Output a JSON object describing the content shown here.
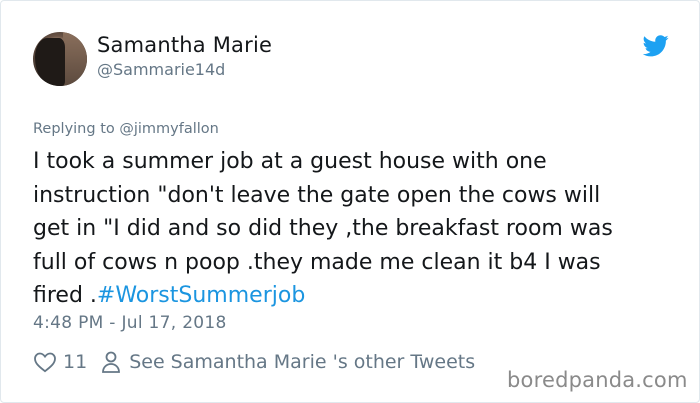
{
  "user": {
    "display_name": "Samantha Marie",
    "handle": "@Sammarie14d"
  },
  "reply": {
    "prefix": "Replying to",
    "mention": "@jimmyfallon"
  },
  "tweet": {
    "lines": [
      "I took a summer job at a guest house with one",
      "instruction \"don't leave the gate open the cows will",
      "get in \"I did and so did they ,the breakfast room was",
      "full of cows n poop .they made me clean it b4 I was"
    ],
    "last_line_text": "fired .",
    "hashtag": "#WorstSummerjob"
  },
  "timestamp": "4:48 PM - Jul 17, 2018",
  "actions": {
    "like_count": "11",
    "other_tweets_label": "See Samantha Marie 's other Tweets"
  },
  "icons": {
    "platform": "twitter-bird-icon",
    "like": "heart-icon",
    "profile": "person-icon"
  },
  "colors": {
    "accent": "#1da1f2",
    "hashtag": "#1b95e0",
    "secondary_text": "#657786",
    "primary_text": "#14171a"
  },
  "watermark": "boredpanda.com"
}
